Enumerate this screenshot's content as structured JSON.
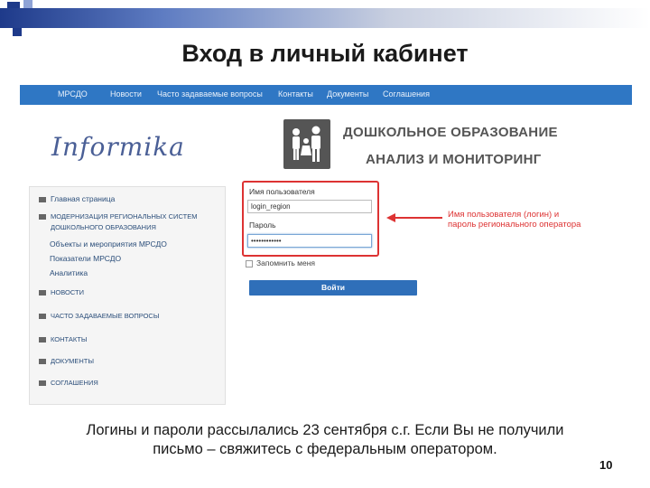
{
  "slide": {
    "title": "Вход в личный кабинет",
    "caption_line1": "Логины и пароли рассылались 23 сентября с.г. Если Вы не получили",
    "caption_line2": "письмо – свяжитесь с федеральным оператором.",
    "page_number": "10"
  },
  "site": {
    "nav": [
      "МРСДО",
      "Новости",
      "Часто задаваемые вопросы",
      "Контакты",
      "Документы",
      "Соглашения"
    ],
    "logo": "Informika",
    "banner_line1": "ДОШКОЛЬНОЕ ОБРАЗОВАНИЕ",
    "banner_line2": "АНАЛИЗ И МОНИТОРИНГ",
    "sidebar": {
      "home": "Главная страница",
      "mod_line1": "МОДЕРНИЗАЦИЯ РЕГИОНАЛЬНЫХ СИСТЕМ",
      "mod_line2": "ДОШКОЛЬНОГО ОБРАЗОВАНИЯ",
      "sub1": "Объекты и мероприятия МРСДО",
      "sub2": "Показатели МРСДО",
      "sub3": "Аналитика",
      "news": "НОВОСТИ",
      "faq": "ЧАСТО ЗАДАВАЕМЫЕ ВОПРОСЫ",
      "contacts": "КОНТАКТЫ",
      "docs": "ДОКУМЕНТЫ",
      "agreements": "СОГЛАШЕНИЯ"
    },
    "login": {
      "username_label": "Имя пользователя",
      "username_value": "login_region",
      "password_label": "Пароль",
      "password_value": "••••••••••••",
      "remember_label": "Запомнить меня",
      "submit_label": "Войти"
    },
    "note_line1": "Имя пользователя (логин) и",
    "note_line2": "пароль регионального оператора"
  },
  "colors": {
    "nav_bg": "#2f77c4",
    "accent_red": "#dd3333",
    "button": "#2f6fb9"
  }
}
